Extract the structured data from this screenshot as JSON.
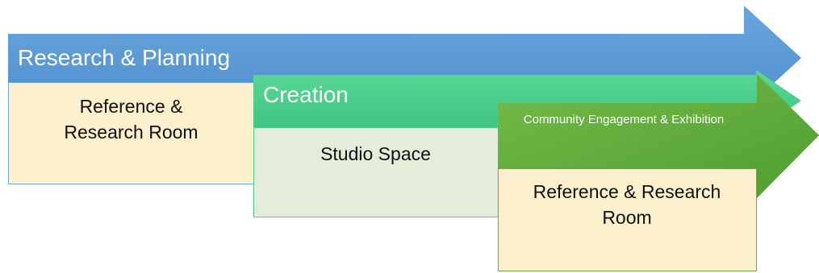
{
  "stages": [
    {
      "title": "Research & Planning",
      "arrow_color": "#5b9bd5",
      "box_text": "Reference & Research Room",
      "box_fill": "#fdf0cd",
      "box_border": "#6fa8dc"
    },
    {
      "title": "Creation",
      "arrow_color": "#4fcc8a",
      "box_text": "Studio Space",
      "box_fill": "#e3edd9",
      "box_border": "#4fcc8a"
    },
    {
      "title": "Community Engagement & Exhibition",
      "arrow_color": "#5fad3c",
      "box_text": "Reference & Research Room",
      "box_fill": "#fdf0cd",
      "box_border": "#6aaa3a"
    }
  ]
}
